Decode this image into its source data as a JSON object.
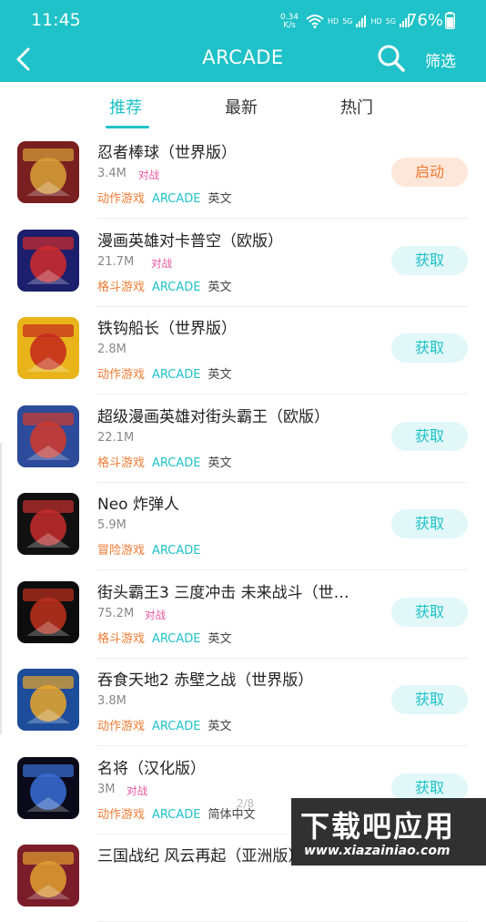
{
  "status_bar": {
    "time": "11:45",
    "net_speed_value": "0.34",
    "net_speed_unit": "K/s",
    "hd1": "HD",
    "sig1": "5G",
    "hd2": "HD",
    "sig2": "5G",
    "battery": "76%"
  },
  "header": {
    "title": "ARCADE",
    "filter_label": "筛选",
    "accent_color": "#1fc2c8"
  },
  "tabs": [
    {
      "label": "推荐",
      "active": true
    },
    {
      "label": "最新",
      "active": false
    },
    {
      "label": "热门",
      "active": false
    }
  ],
  "games": [
    {
      "name": "忍者棒球（世界版）",
      "size": "3.4M",
      "tag": "对战",
      "genre": "动作游戏",
      "platform": "ARCADE",
      "lang": "英文",
      "action": "启动",
      "thumb_colors": [
        "#7a1f1f",
        "#d8a23a"
      ]
    },
    {
      "name": "漫画英雄对卡普空（欧版）",
      "size": "21.7M",
      "tag": "对战",
      "genre": "格斗游戏",
      "platform": "ARCADE",
      "lang": "英文",
      "action": "获取",
      "thumb_colors": [
        "#1c1f6b",
        "#d12b2b"
      ]
    },
    {
      "name": "铁钩船长（世界版）",
      "size": "2.8M",
      "tag": "",
      "genre": "动作游戏",
      "platform": "ARCADE",
      "lang": "英文",
      "action": "获取",
      "thumb_colors": [
        "#e8b41a",
        "#c4261d"
      ]
    },
    {
      "name": "超级漫画英雄对街头霸王（欧版）",
      "size": "22.1M",
      "tag": "",
      "genre": "格斗游戏",
      "platform": "ARCADE",
      "lang": "英文",
      "action": "获取",
      "thumb_colors": [
        "#2c4b9b",
        "#d33a2c"
      ]
    },
    {
      "name": "Neo 炸弹人",
      "size": "5.9M",
      "tag": "",
      "genre": "冒险游戏",
      "platform": "ARCADE",
      "lang": "",
      "action": "获取",
      "thumb_colors": [
        "#111111",
        "#c62d2d"
      ]
    },
    {
      "name": "街头霸王3 三度冲击 未来战斗（世…",
      "size": "75.2M",
      "tag": "对战",
      "genre": "格斗游戏",
      "platform": "ARCADE",
      "lang": "英文",
      "action": "获取",
      "thumb_colors": [
        "#0d0d0d",
        "#c1311f"
      ]
    },
    {
      "name": "吞食天地2 赤壁之战（世界版）",
      "size": "3.8M",
      "tag": "",
      "genre": "动作游戏",
      "platform": "ARCADE",
      "lang": "英文",
      "action": "获取",
      "thumb_colors": [
        "#1d4d9a",
        "#e9a72a"
      ]
    },
    {
      "name": "名将（汉化版）",
      "size": "3M",
      "tag": "对战",
      "genre": "动作游戏",
      "platform": "ARCADE",
      "lang": "简体中文",
      "action": "获取",
      "thumb_colors": [
        "#0a0a1a",
        "#3a6fd8"
      ]
    },
    {
      "name": "三国战纪 风云再起（亚洲版）",
      "size": "",
      "tag": "",
      "genre": "",
      "platform": "",
      "lang": "",
      "action": "",
      "thumb_colors": [
        "#7b1c2a",
        "#e0a030"
      ]
    }
  ],
  "page_indicator": "2/8",
  "watermark": {
    "title": "下载吧应用",
    "url": "www.xiazainiao.com"
  }
}
